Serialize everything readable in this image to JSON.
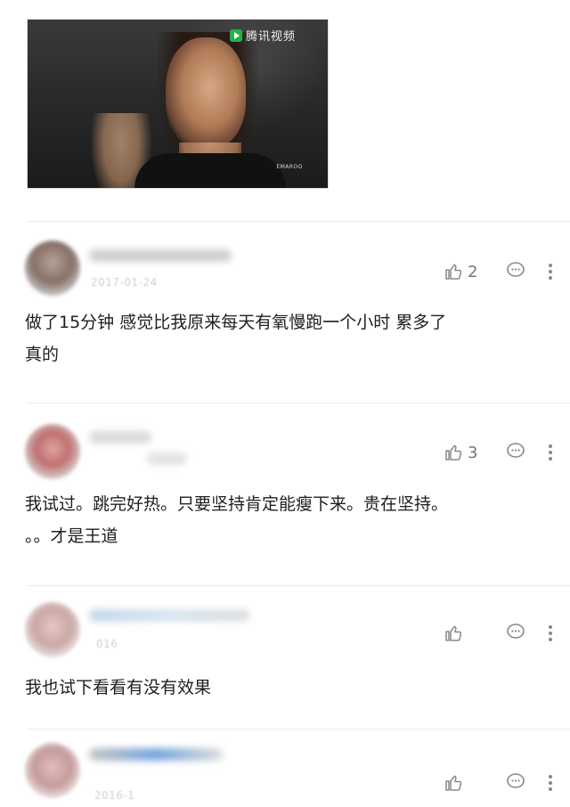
{
  "video": {
    "watermark": "腾讯视频",
    "brand_mark": "EMAROO"
  },
  "comments": [
    {
      "date": "2017-01-24",
      "likes": "2",
      "text": "做了15分钟 感觉比我原来每天有氧慢跑一个小时 累多了\n真的"
    },
    {
      "date": "",
      "likes": "3",
      "text": "我试过。跳完好热。只要坚持肯定能瘦下来。贵在坚持。\n。。才是王道"
    },
    {
      "date": "016",
      "likes": "",
      "text": "我也试下看看有没有效果"
    },
    {
      "date": "2016-1",
      "likes": "",
      "text": ""
    }
  ]
}
